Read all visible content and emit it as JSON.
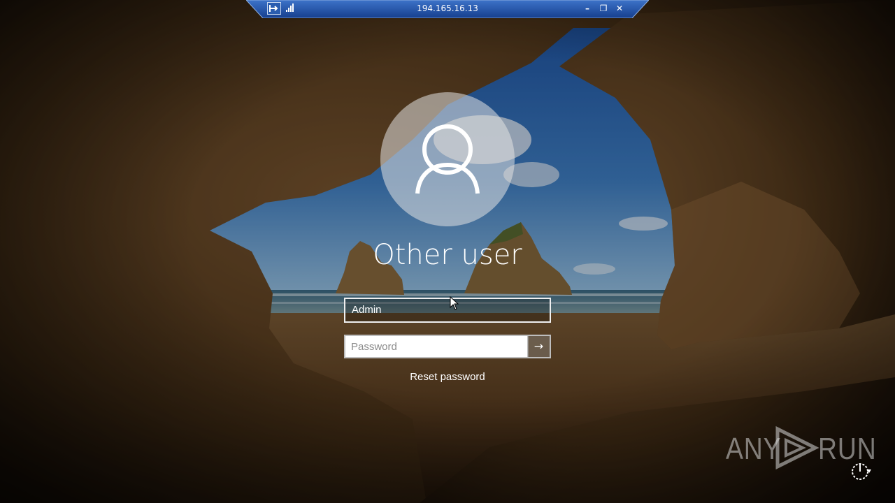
{
  "rdp_bar": {
    "host": "194.165.16.13",
    "pin_icon": "pin-icon",
    "signal_icon": "connection-signal-icon",
    "minimize_glyph": "–",
    "restore_glyph": "❐",
    "close_glyph": "✕"
  },
  "login": {
    "avatar_icon": "user-avatar-icon",
    "user_display_name": "Other user",
    "username_value": "Admin",
    "password_placeholder": "Password",
    "submit_glyph": "→",
    "reset_password_label": "Reset password"
  },
  "watermark": {
    "left_text": "ANY",
    "right_text": "RUN"
  },
  "colors": {
    "rdp_bar_blue": "#1f4ea3",
    "text": "#ffffff",
    "field_border": "#f0f0f0"
  }
}
